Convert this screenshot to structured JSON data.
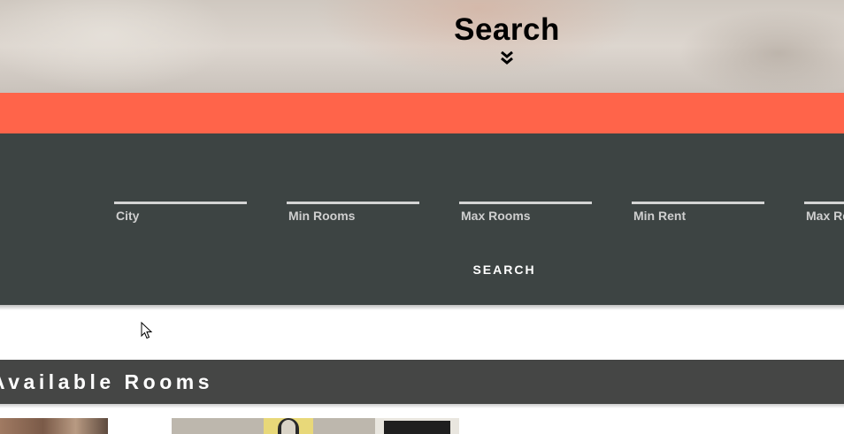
{
  "hero": {
    "title": "Search",
    "scroll_icon": "double-chevron-down-icon"
  },
  "search_form": {
    "fields": [
      {
        "label": "City"
      },
      {
        "label": "Min Rooms"
      },
      {
        "label": "Max Rooms"
      },
      {
        "label": "Min Rent"
      },
      {
        "label": "Max Rent"
      }
    ],
    "submit_label": "SEARCH"
  },
  "rooms_section": {
    "title": "Available Rooms"
  },
  "colors": {
    "accent": "#ff644a",
    "form_background": "#3d4443",
    "section_header": "#454645"
  }
}
